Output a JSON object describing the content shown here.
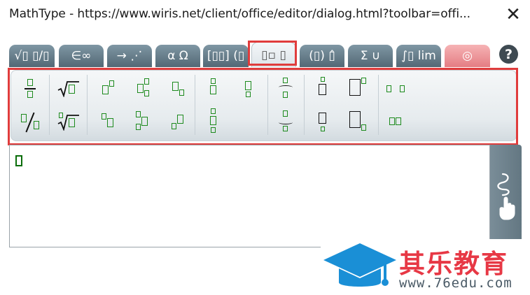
{
  "window": {
    "title": "MathType - https://www.wiris.net/client/office/editor/dialog.html?toolbar=offi...",
    "close_symbol": "✕"
  },
  "tabs": [
    {
      "label": "√▯ ▯/▯",
      "name": "tab-radicals-fractions"
    },
    {
      "label": "∈∞",
      "name": "tab-symbols"
    },
    {
      "label": "→ ⋰",
      "name": "tab-arrows"
    },
    {
      "label": "α Ω",
      "name": "tab-greek"
    },
    {
      "label": "[▯▯] (▯",
      "name": "tab-matrices"
    },
    {
      "label": "▯▫ ▯",
      "name": "tab-scripts",
      "active": true
    },
    {
      "label": "(▯) ▯̂",
      "name": "tab-brackets-accents"
    },
    {
      "label": "Σ ∪",
      "name": "tab-big-operators"
    },
    {
      "label": "∫▯ lim",
      "name": "tab-calculus"
    },
    {
      "label": "◎",
      "name": "tab-contextual"
    }
  ],
  "help_symbol": "?",
  "editor": {
    "content": ""
  },
  "watermark": {
    "brand": "其乐教育",
    "url": "www.76edu.com"
  }
}
